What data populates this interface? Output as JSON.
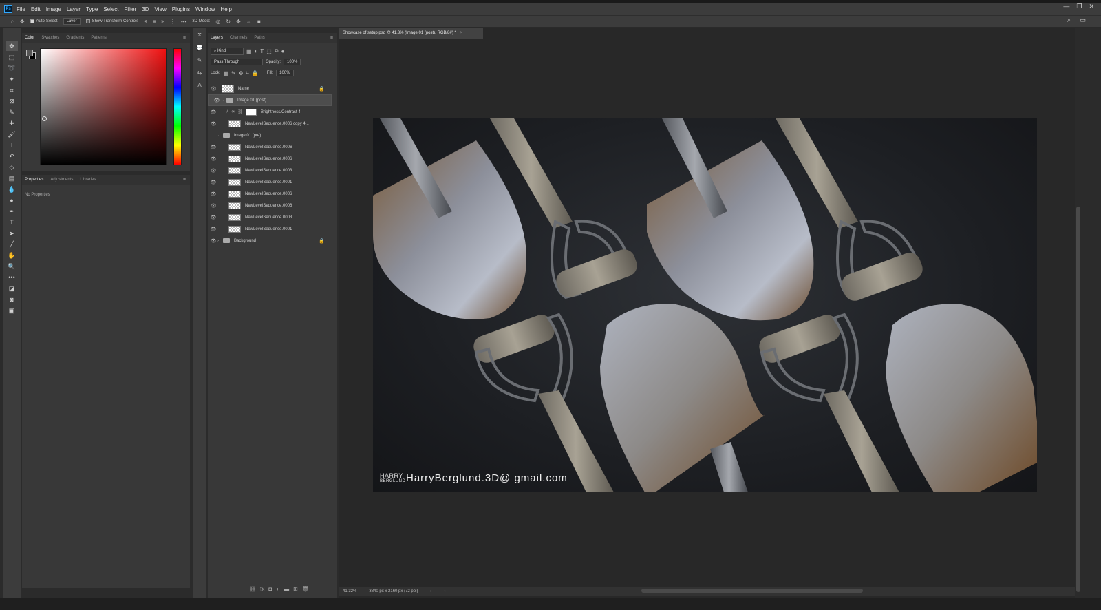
{
  "app": {
    "logo_text": "Ps"
  },
  "menu": [
    "File",
    "Edit",
    "Image",
    "Layer",
    "Type",
    "Select",
    "Filter",
    "3D",
    "View",
    "Plugins",
    "Window",
    "Help"
  ],
  "window_controls": [
    "—",
    "❐",
    "✕"
  ],
  "options": {
    "auto_select_label": "Auto-Select",
    "auto_select_target": "Layer",
    "show_transform_label": "Show Transform Controls",
    "mode_3d_label": "3D Mode:"
  },
  "color_panel": {
    "tabs": [
      "Color",
      "Swatches",
      "Gradients",
      "Patterns"
    ]
  },
  "properties_panel": {
    "tabs": [
      "Properties",
      "Adjustments",
      "Libraries"
    ],
    "empty_text": "No Properties"
  },
  "layers_panel": {
    "tabs": [
      "Layers",
      "Channels",
      "Paths"
    ],
    "filter_kind": "Kind",
    "blend_mode": "Pass Through",
    "opacity_label": "Opacity:",
    "opacity_value": "100%",
    "lock_label": "Lock:",
    "fill_label": "Fill:",
    "fill_value": "100%",
    "layers": [
      {
        "name": "Name",
        "type": "layer",
        "locked": true
      },
      {
        "name": "Image 01 (post)",
        "type": "group",
        "selected": true
      },
      {
        "name": "Brightness/Contrast 4",
        "type": "adjustment"
      },
      {
        "name": "NewLevelSequence.0006 copy 4...",
        "type": "layer"
      },
      {
        "name": "Image 01 (pre)",
        "type": "group"
      },
      {
        "name": "NewLevelSequence.0006",
        "type": "layer"
      },
      {
        "name": "NewLevelSequence.0006",
        "type": "layer"
      },
      {
        "name": "NewLevelSequence.0003",
        "type": "layer"
      },
      {
        "name": "NewLevelSequence.0001",
        "type": "layer"
      },
      {
        "name": "NewLevelSequence.0006",
        "type": "layer"
      },
      {
        "name": "NewLevelSequence.0006",
        "type": "layer"
      },
      {
        "name": "NewLevelSequence.0003",
        "type": "layer"
      },
      {
        "name": "NewLevelSequence.0001",
        "type": "layer"
      },
      {
        "name": "Background",
        "type": "group",
        "locked": true
      }
    ]
  },
  "document": {
    "tab_title": "Showcase of setup.psd @ 41,3% (Image 01 (post), RGB/8#) *",
    "zoom": "41,32%",
    "dimensions": "3840 px x 2160 px (72 ppi)"
  },
  "artwork": {
    "watermark_small_1": "HARRY",
    "watermark_small_2": "BERGLUND",
    "watermark_email": "HarryBerglund.3D@ gmail.com"
  }
}
